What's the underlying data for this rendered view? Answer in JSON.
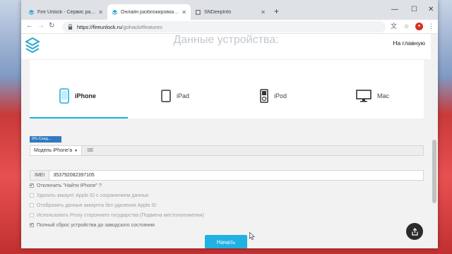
{
  "browser": {
    "tabs": [
      {
        "label": "Fire Unlock - Сервис разблокир...",
        "active": false
      },
      {
        "label": "Онлайн разблокировка - Fire U...",
        "active": true
      },
      {
        "label": "SNDeepInfo",
        "active": false
      }
    ],
    "url_host": "https://fireunlock.ru",
    "url_path": "/gohack#features"
  },
  "site": {
    "header_title": "Данные устройства:",
    "home_link": "На главную"
  },
  "device_tabs": [
    {
      "label": "iPhone",
      "icon": "iphone-icon",
      "active": true
    },
    {
      "label": "iPad",
      "icon": "ipad-icon",
      "active": false
    },
    {
      "label": "iPod",
      "icon": "ipod-icon",
      "active": false
    },
    {
      "label": "Mac",
      "icon": "mac-icon",
      "active": false
    }
  ],
  "progress": {
    "label": "0% Соед...",
    "value_percent": 0
  },
  "model": {
    "select_label": "Модель iPhone'а",
    "value": "SE"
  },
  "imei": {
    "label": "IMEI",
    "value": "353792082397105"
  },
  "options": [
    {
      "label": "Отключить \"Найти iPhone\" ?",
      "checked": true
    },
    {
      "label": "Удалить аккаунт Apple ID с сохранением данных",
      "checked": false
    },
    {
      "label": "Отобразить данные аккаунта без удаления Apple ID",
      "checked": false
    },
    {
      "label": "Использовать Proxy стороннего государства (Подмена местоположения)",
      "checked": false
    },
    {
      "label": "Полный сброс устройства до заводского состояния",
      "checked": true
    }
  ],
  "start_button": "Начать",
  "colors": {
    "accent": "#21b1e3",
    "progress": "#2f7ac0"
  }
}
